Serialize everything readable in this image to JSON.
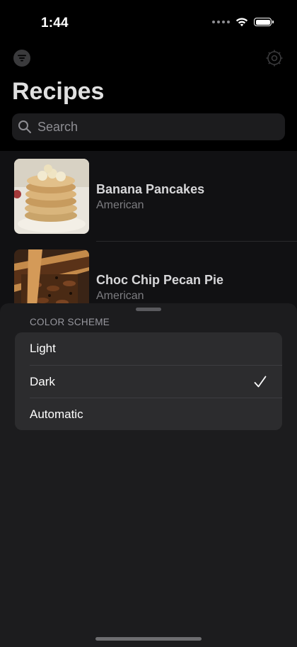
{
  "status_bar": {
    "time": "1:44"
  },
  "nav": {
    "title": "Recipes"
  },
  "search": {
    "placeholder": "Search"
  },
  "recipes": [
    {
      "name": "Banana Pancakes",
      "cuisine": "American"
    },
    {
      "name": "Choc Chip Pecan Pie",
      "cuisine": "American"
    }
  ],
  "sheet": {
    "section_header": "COLOR SCHEME",
    "options": [
      {
        "label": "Light",
        "selected": false
      },
      {
        "label": "Dark",
        "selected": true
      },
      {
        "label": "Automatic",
        "selected": false
      }
    ]
  },
  "icons": {
    "filter": "line-3-horizontal-decrease-circle-icon",
    "settings": "gear-icon",
    "search": "magnifying-glass-icon",
    "checkmark": "checkmark-icon",
    "wifi": "wifi-icon",
    "battery": "battery-icon"
  },
  "colors": {
    "background": "#000000",
    "sheet": "#1c1c1e",
    "grouped_cell": "#2c2c2e",
    "secondary_text": "#8e8e93"
  }
}
